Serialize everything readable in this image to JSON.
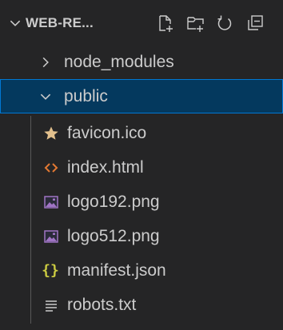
{
  "explorer": {
    "title": "WEB-RE...",
    "toolbar": {
      "new_file_icon": "new-file-icon",
      "new_folder_icon": "new-folder-icon",
      "refresh_icon": "refresh-icon",
      "collapse_icon": "collapse-all-icon"
    },
    "items": [
      {
        "label": "node_modules",
        "type": "folder",
        "expanded": false
      },
      {
        "label": "public",
        "type": "folder",
        "expanded": true,
        "selected": true
      },
      {
        "label": "favicon.ico",
        "type": "file",
        "icon": "star-icon",
        "icon_color": "#e2c08d"
      },
      {
        "label": "index.html",
        "type": "file",
        "icon": "html-icon",
        "icon_color": "#e37933"
      },
      {
        "label": "logo192.png",
        "type": "file",
        "icon": "image-icon",
        "icon_color": "#a074c4"
      },
      {
        "label": "logo512.png",
        "type": "file",
        "icon": "image-icon",
        "icon_color": "#a074c4"
      },
      {
        "label": "manifest.json",
        "type": "file",
        "icon": "json-braces-icon",
        "icon_color": "#cbcb41",
        "icon_text": "{}"
      },
      {
        "label": "robots.txt",
        "type": "file",
        "icon": "text-lines-icon",
        "icon_color": "#cccccc"
      }
    ]
  },
  "colors": {
    "background": "#252526",
    "selection": "#04395e",
    "selection_border": "#0078d4",
    "text": "#cccccc"
  }
}
